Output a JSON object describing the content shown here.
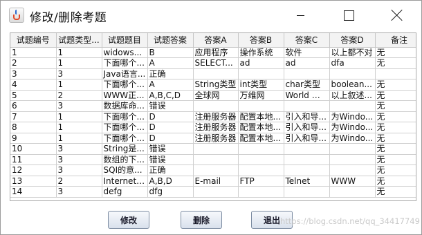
{
  "window": {
    "title": "修改/删除考题"
  },
  "table": {
    "columns": [
      "试题编号",
      "试题类型...",
      "试题题目",
      "试题答案",
      "答案A",
      "答案B",
      "答案C",
      "答案D",
      "备注"
    ],
    "rows": [
      [
        "1",
        "1",
        "widows...",
        "B",
        "应用程序",
        "操作系统",
        "软件",
        "以上都不对",
        "无"
      ],
      [
        "2",
        "1",
        "下面哪个...",
        "A",
        "SELECT...",
        "ad",
        "ad",
        "dfa",
        "无"
      ],
      [
        "3",
        "3",
        "Java语言...",
        "正确",
        "",
        "",
        "",
        "",
        ""
      ],
      [
        "4",
        "1",
        "下面哪个...",
        "A",
        "String类型",
        "int类型",
        "char类型",
        "boolean...",
        "无"
      ],
      [
        "5",
        "2",
        "WWW正...",
        "A,B,C,D",
        "全球网",
        "万维网",
        "World Wi...",
        "以上叙述...",
        "无"
      ],
      [
        "6",
        "3",
        "数据库命...",
        "错误",
        "",
        "",
        "",
        "",
        "无"
      ],
      [
        "7",
        "1",
        "下面哪个...",
        "D",
        "注册服务器",
        "配置本地...",
        "引入和导...",
        "为Windo...",
        "无"
      ],
      [
        "8",
        "1",
        "下面哪个...",
        "D",
        "注册服务器",
        "配置本地...",
        "引入和导...",
        "为Windo...",
        "无"
      ],
      [
        "9",
        "1",
        "下面哪个...",
        "D",
        "注册服务器",
        "配置本地...",
        "引入和导...",
        "为Windo...",
        "无"
      ],
      [
        "10",
        "3",
        "String是...",
        "错误",
        "",
        "",
        "",
        "",
        "无"
      ],
      [
        "11",
        "3",
        "数组的下...",
        "错误",
        "",
        "",
        "",
        "",
        "无"
      ],
      [
        "12",
        "3",
        "SQI的意...",
        "正确",
        "",
        "",
        "",
        "",
        "无"
      ],
      [
        "13",
        "2",
        "Internet提...",
        "A,B,D",
        "E-mail",
        "FTP",
        "Telnet",
        "WWW",
        "无"
      ],
      [
        "14",
        "3",
        "defg",
        "dfg",
        "",
        "",
        "",
        "",
        "无"
      ]
    ]
  },
  "buttons": {
    "edit": "修改",
    "delete": "删除",
    "exit": "退出"
  },
  "watermark": "https://blog.csdn.net/qq_34417749"
}
